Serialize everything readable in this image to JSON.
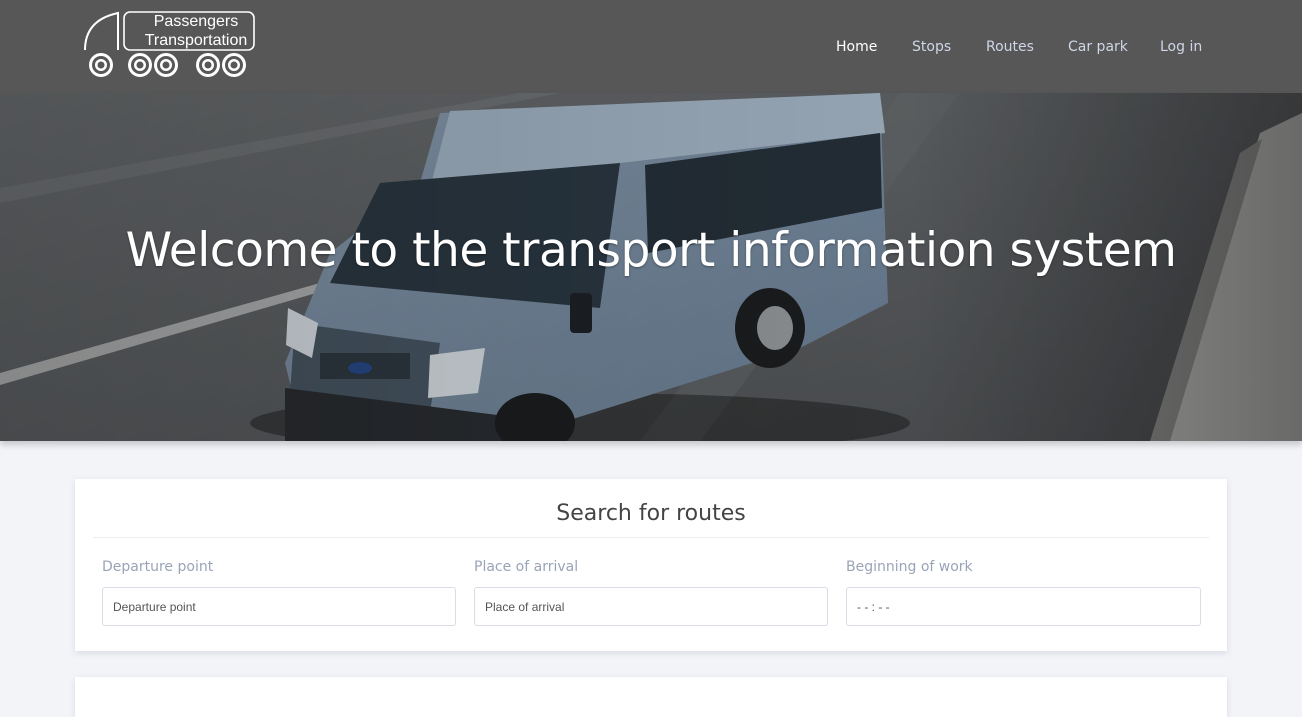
{
  "brand": {
    "line1": "Passengers",
    "line2": "Transportation"
  },
  "nav": {
    "items": [
      {
        "label": "Home",
        "active": true
      },
      {
        "label": "Stops",
        "active": false
      },
      {
        "label": "Routes",
        "active": false
      },
      {
        "label": "Car park",
        "active": false
      },
      {
        "label": "Log in",
        "active": false
      }
    ]
  },
  "hero": {
    "title": "Welcome to the transport information system"
  },
  "search": {
    "title": "Search for routes",
    "fields": [
      {
        "label": "Departure point",
        "placeholder": "Departure point"
      },
      {
        "label": "Place of arrival",
        "placeholder": "Place of arrival"
      },
      {
        "label": "Beginning of work",
        "placeholder": "- - : - -"
      }
    ]
  },
  "colors": {
    "header_bg": "#575757",
    "page_bg": "#f2f4f8",
    "nav_text": "#cfd6e6",
    "label_text": "#9aa3b8"
  }
}
